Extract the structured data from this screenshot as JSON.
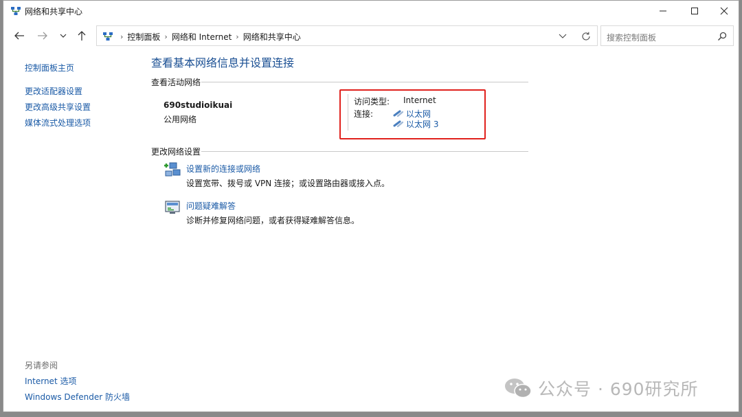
{
  "window": {
    "title": "网络和共享中心"
  },
  "navigation": {
    "breadcrumbs": [
      "控制面板",
      "网络和 Internet",
      "网络和共享中心"
    ],
    "search_placeholder": "搜索控制面板"
  },
  "sidebar": {
    "home_link": "控制面板主页",
    "links": [
      "更改适配器设置",
      "更改高级共享设置",
      "媒体流式处理选项"
    ],
    "see_also_title": "另请参阅",
    "see_also_links": [
      "Internet 选项",
      "Windows Defender 防火墙"
    ]
  },
  "main": {
    "page_title": "查看基本网络信息并设置连接",
    "active_section_title": "查看活动网络",
    "network": {
      "name": "690studioikuai",
      "category": "公用网络",
      "access_type_label": "访问类型:",
      "access_type_value": "Internet",
      "connections_label": "连接:",
      "connections": [
        "以太网",
        "以太网 3"
      ]
    },
    "change_section_title": "更改网络设置",
    "tasks": [
      {
        "link": "设置新的连接或网络",
        "description": "设置宽带、拨号或 VPN 连接；或设置路由器或接入点。",
        "icon": "new-connection-icon"
      },
      {
        "link": "问题疑难解答",
        "description": "诊断并修复网络问题，或者获得疑难解答信息。",
        "icon": "troubleshoot-icon"
      }
    ]
  },
  "watermark": {
    "text": "公众号 · 690研究所"
  },
  "colors": {
    "link": "#1a5aa6",
    "title": "#1a4f93",
    "highlight": "#e0201c"
  }
}
